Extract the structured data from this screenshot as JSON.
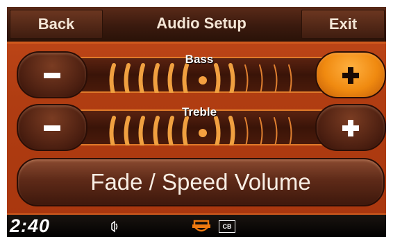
{
  "header": {
    "back_label": "Back",
    "title": "Audio Setup",
    "exit_label": "Exit"
  },
  "sliders": [
    {
      "label": "Bass",
      "level_fraction": 0.5
    },
    {
      "label": "Treble",
      "level_fraction": 0.5
    }
  ],
  "fade_button_label": "Fade / Speed Volume",
  "status": {
    "time": "2:40",
    "cb_label": "CB"
  },
  "colors": {
    "accent": "#f08a10",
    "background": "#b03d12",
    "bar": "#3a1a0e"
  }
}
